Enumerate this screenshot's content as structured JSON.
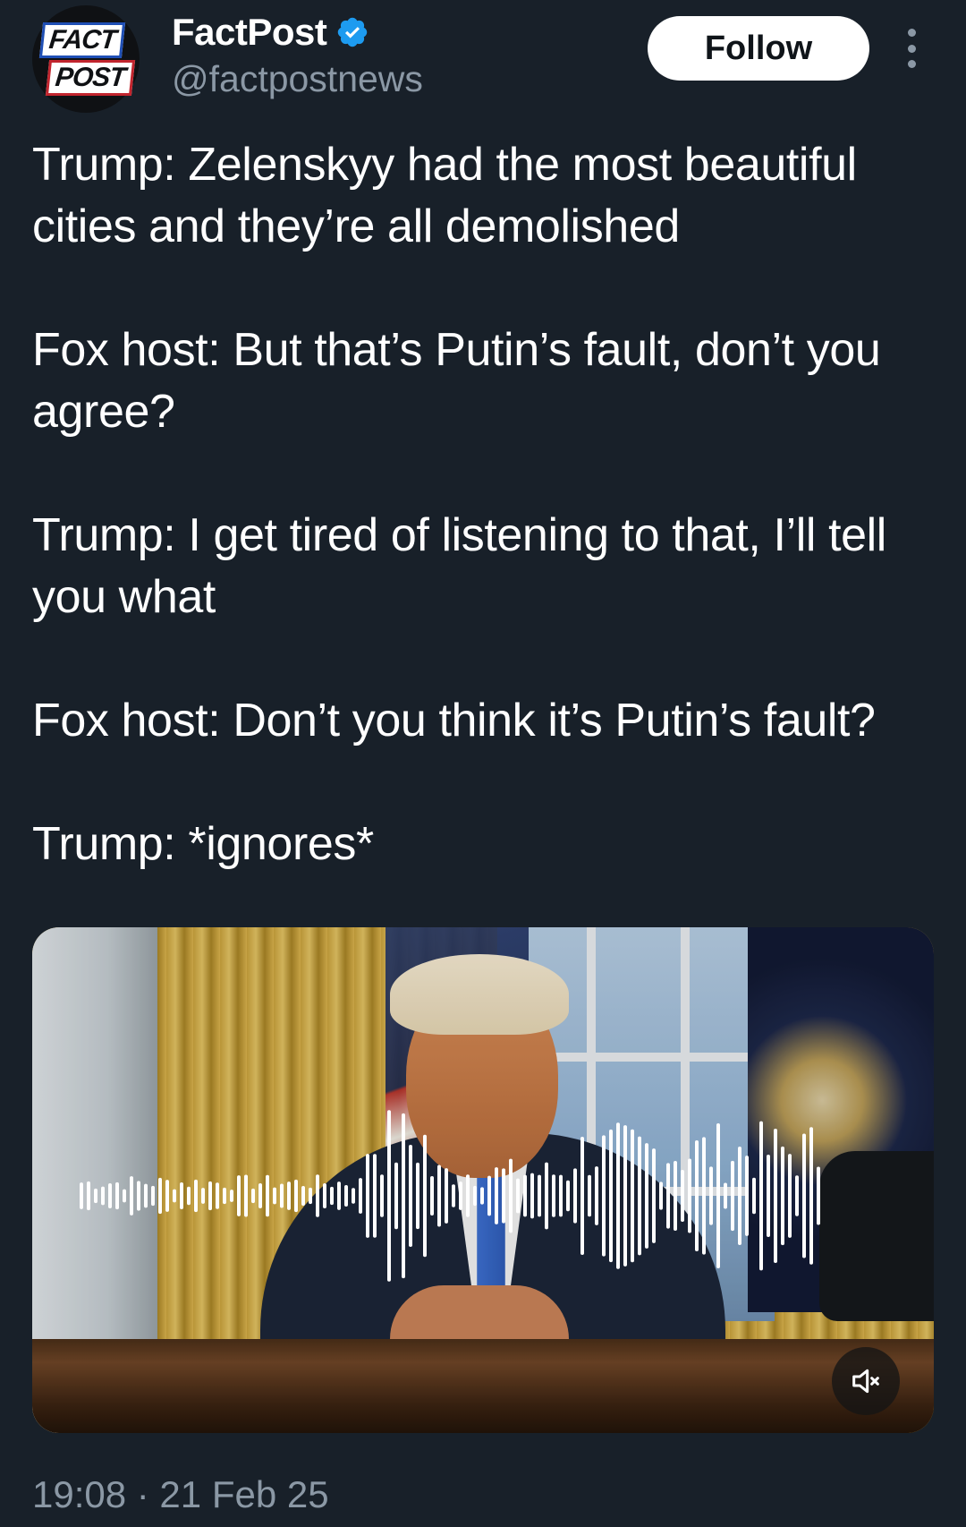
{
  "account": {
    "display_name": "FactPost",
    "handle": "@factpostnews",
    "verified": true,
    "avatar_logo": [
      "FACT",
      "POST"
    ]
  },
  "header": {
    "follow_label": "Follow",
    "more_icon": "more-vertical-icon"
  },
  "tweet": {
    "paragraphs": [
      "Trump: Zelenskyy had the most beautiful cities and they’re all demolished",
      "Fox host: But that’s Putin’s fault, don’t you agree?",
      "Trump: I get tired of listening to that, I’ll tell you what",
      "Fox host: Don’t you think it’s Putin’s fault?",
      "Trump: *ignores*"
    ]
  },
  "media": {
    "type": "audio-video-with-waveform",
    "mute_icon": "speaker-muted-icon"
  },
  "meta": {
    "timestamp": "19:08 · 21 Feb 25"
  },
  "colors": {
    "background": "#182029",
    "secondary_text": "#8b98a5",
    "verified_badge": "#1d9bf0",
    "follow_button_bg": "#ffffff"
  }
}
